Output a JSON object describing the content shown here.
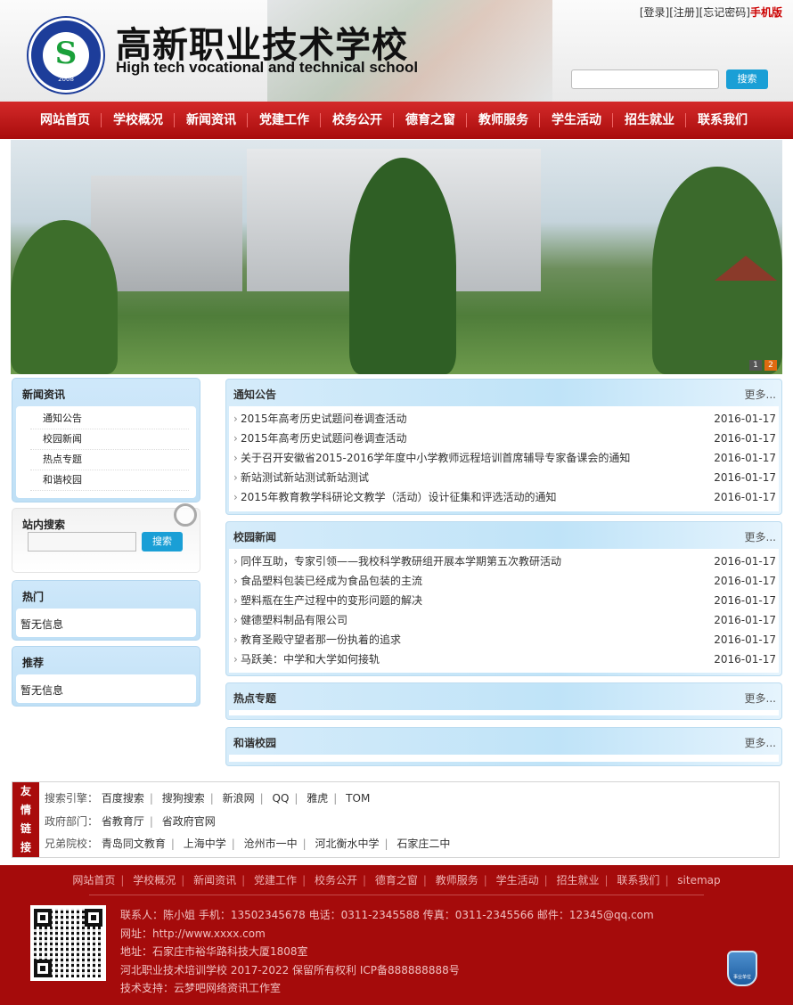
{
  "header": {
    "school_cn": "高新职业技术学校",
    "school_en": "High tech vocational and technical school",
    "logo_year": "2008",
    "top_links": {
      "login": "[登录]",
      "register": "[注册]",
      "forgot": "[忘记密码]",
      "mobile": "手机版"
    },
    "search_button": "搜索"
  },
  "nav": {
    "items": [
      "网站首页",
      "学校概况",
      "新闻资讯",
      "党建工作",
      "校务公开",
      "德育之窗",
      "教师服务",
      "学生活动",
      "招生就业",
      "联系我们"
    ]
  },
  "banner": {
    "dots": [
      "1",
      "2"
    ]
  },
  "sidebar": {
    "news": {
      "title": "新闻资讯",
      "items": [
        "通知公告",
        "校园新闻",
        "热点专题",
        "和谐校园"
      ]
    },
    "search": {
      "title": "站内搜索",
      "button": "搜索"
    },
    "hot": {
      "title": "热门",
      "empty": "暂无信息"
    },
    "recommend": {
      "title": "推荐",
      "empty": "暂无信息"
    }
  },
  "panels": {
    "notice": {
      "title": "通知公告",
      "more": "更多...",
      "items": [
        {
          "text": "2015年高考历史试题问卷调查活动",
          "date": "2016-01-17"
        },
        {
          "text": "2015年高考历史试题问卷调查活动",
          "date": "2016-01-17"
        },
        {
          "text": "关于召开安徽省2015-2016学年度中小学教师远程培训首席辅导专家备课会的通知",
          "date": "2016-01-17"
        },
        {
          "text": "新站测试新站测试新站测试",
          "date": "2016-01-17"
        },
        {
          "text": "2015年教育教学科研论文教学（活动）设计征集和评选活动的通知",
          "date": "2016-01-17"
        }
      ]
    },
    "campus": {
      "title": "校园新闻",
      "more": "更多...",
      "items": [
        {
          "text": "同伴互助，专家引领——我校科学教研组开展本学期第五次教研活动",
          "date": "2016-01-17"
        },
        {
          "text": "食品塑料包装已经成为食品包装的主流",
          "date": "2016-01-17"
        },
        {
          "text": "塑料瓶在生产过程中的变形问题的解决",
          "date": "2016-01-17"
        },
        {
          "text": "健德塑料制品有限公司",
          "date": "2016-01-17"
        },
        {
          "text": "教育圣殿守望者那一份执着的追求",
          "date": "2016-01-17"
        },
        {
          "text": "马跃美：中学和大学如何接轨",
          "date": "2016-01-17"
        }
      ]
    },
    "hot": {
      "title": "热点专题",
      "more": "更多..."
    },
    "harmony": {
      "title": "和谐校园",
      "more": "更多..."
    }
  },
  "links": {
    "label": [
      "友",
      "情",
      "链",
      "接"
    ],
    "search_label": "搜索引擎：",
    "search": [
      "百度搜索",
      "搜狗搜索",
      "新浪网",
      "QQ",
      "雅虎",
      "TOM"
    ],
    "gov_label": "政府部门：",
    "gov": [
      "省教育厅",
      "省政府官网"
    ],
    "school_label": "兄弟院校：",
    "schools": [
      "青岛同文教育",
      "上海中学",
      "沧州市一中",
      "河北衡水中学",
      "石家庄二中"
    ]
  },
  "footer": {
    "nav": [
      "网站首页",
      "学校概况",
      "新闻资讯",
      "党建工作",
      "校务公开",
      "德育之窗",
      "教师服务",
      "学生活动",
      "招生就业",
      "联系我们",
      "sitemap"
    ],
    "contact": "联系人：陈小姐  手机：13502345678  电话：0311-2345588  传真：0311-2345566  邮件：12345@qq.com",
    "site": "网址：http://www.xxxx.com",
    "address": "地址：石家庄市裕华路科技大厦1808室",
    "copyright": "河北职业技术培训学校 2017-2022 保留所有权利 ICP备888888888号",
    "support": "技术支持：云梦吧网络资讯工作室",
    "badge": "事业单位"
  },
  "colors": {
    "brand_red": "#a90c0c",
    "accent_blue": "#1a9fd6"
  }
}
